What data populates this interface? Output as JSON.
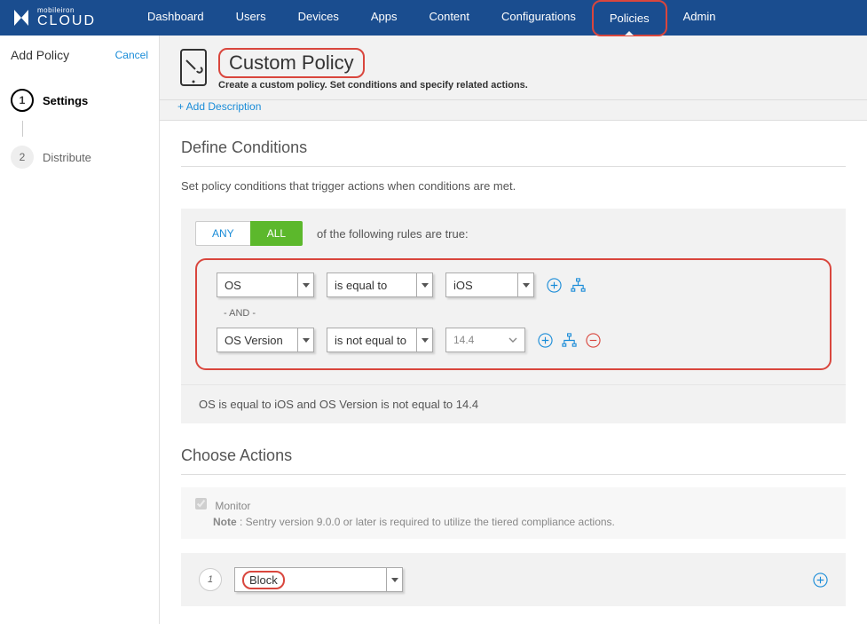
{
  "brand": {
    "small": "mobileiron",
    "large": "CLOUD"
  },
  "nav": {
    "items": [
      "Dashboard",
      "Users",
      "Devices",
      "Apps",
      "Content",
      "Configurations",
      "Policies",
      "Admin"
    ],
    "active": "Policies"
  },
  "sidebar": {
    "title": "Add Policy",
    "cancel": "Cancel",
    "steps": [
      {
        "num": "1",
        "label": "Settings",
        "active": true
      },
      {
        "num": "2",
        "label": "Distribute",
        "active": false
      }
    ]
  },
  "header": {
    "title": "Custom Policy",
    "subtitle": "Create a custom policy. Set conditions and specify related actions.",
    "add_description": "+ Add Description"
  },
  "conditions": {
    "section_title": "Define Conditions",
    "section_desc": "Set policy conditions that trigger actions when conditions are met.",
    "toggle_any": "ANY",
    "toggle_all": "ALL",
    "rules_label": "of the following rules are true:",
    "rule1": {
      "field": "OS",
      "op": "is equal to",
      "val": "iOS"
    },
    "and_label": "- AND -",
    "rule2": {
      "field": "OS Version",
      "op": "is not equal to",
      "val": "14.4"
    },
    "summary": "OS is equal to iOS and OS Version is not equal to 14.4"
  },
  "actions": {
    "section_title": "Choose Actions",
    "monitor_label": "Monitor",
    "monitor_note_bold": "Note",
    "monitor_note_text": " : Sentry version 9.0.0 or later is required to utilize the tiered compliance actions.",
    "row1": {
      "num": "1",
      "value": "Block"
    }
  }
}
